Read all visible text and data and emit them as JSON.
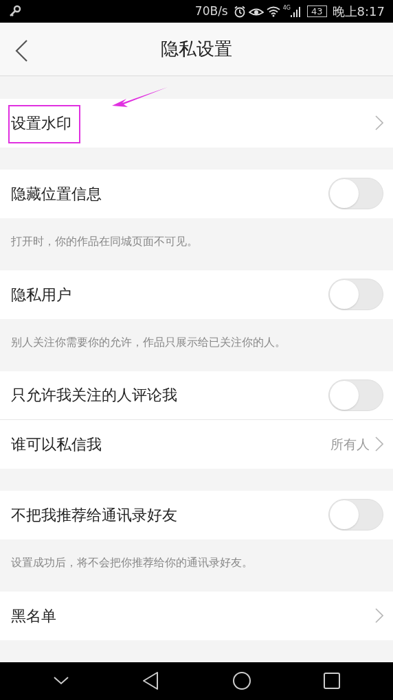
{
  "status_bar": {
    "speed": "70B/s",
    "network": "4G",
    "battery": "43",
    "time": "晚上8:17"
  },
  "header": {
    "title": "隐私设置"
  },
  "sections": [
    {
      "rows": [
        {
          "kind": "link",
          "label": "设置水印",
          "highlighted": true
        }
      ]
    },
    {
      "rows": [
        {
          "kind": "toggle",
          "label": "隐藏位置信息",
          "on": false
        }
      ],
      "note": "打开时，你的作品在同城页面不可见。"
    },
    {
      "rows": [
        {
          "kind": "toggle",
          "label": "隐私用户",
          "on": false
        }
      ],
      "note": "别人关注你需要你的允许，作品只展示给已关注你的人。"
    },
    {
      "rows": [
        {
          "kind": "toggle",
          "label": "只允许我关注的人评论我",
          "on": false
        },
        {
          "kind": "value",
          "label": "谁可以私信我",
          "value": "所有人"
        }
      ]
    },
    {
      "rows": [
        {
          "kind": "toggle",
          "label": "不把我推荐给通讯录好友",
          "on": false
        }
      ],
      "note": "设置成功后，将不会把你推荐给你的通讯录好友。"
    },
    {
      "rows": [
        {
          "kind": "link",
          "label": "黑名单"
        }
      ]
    }
  ]
}
